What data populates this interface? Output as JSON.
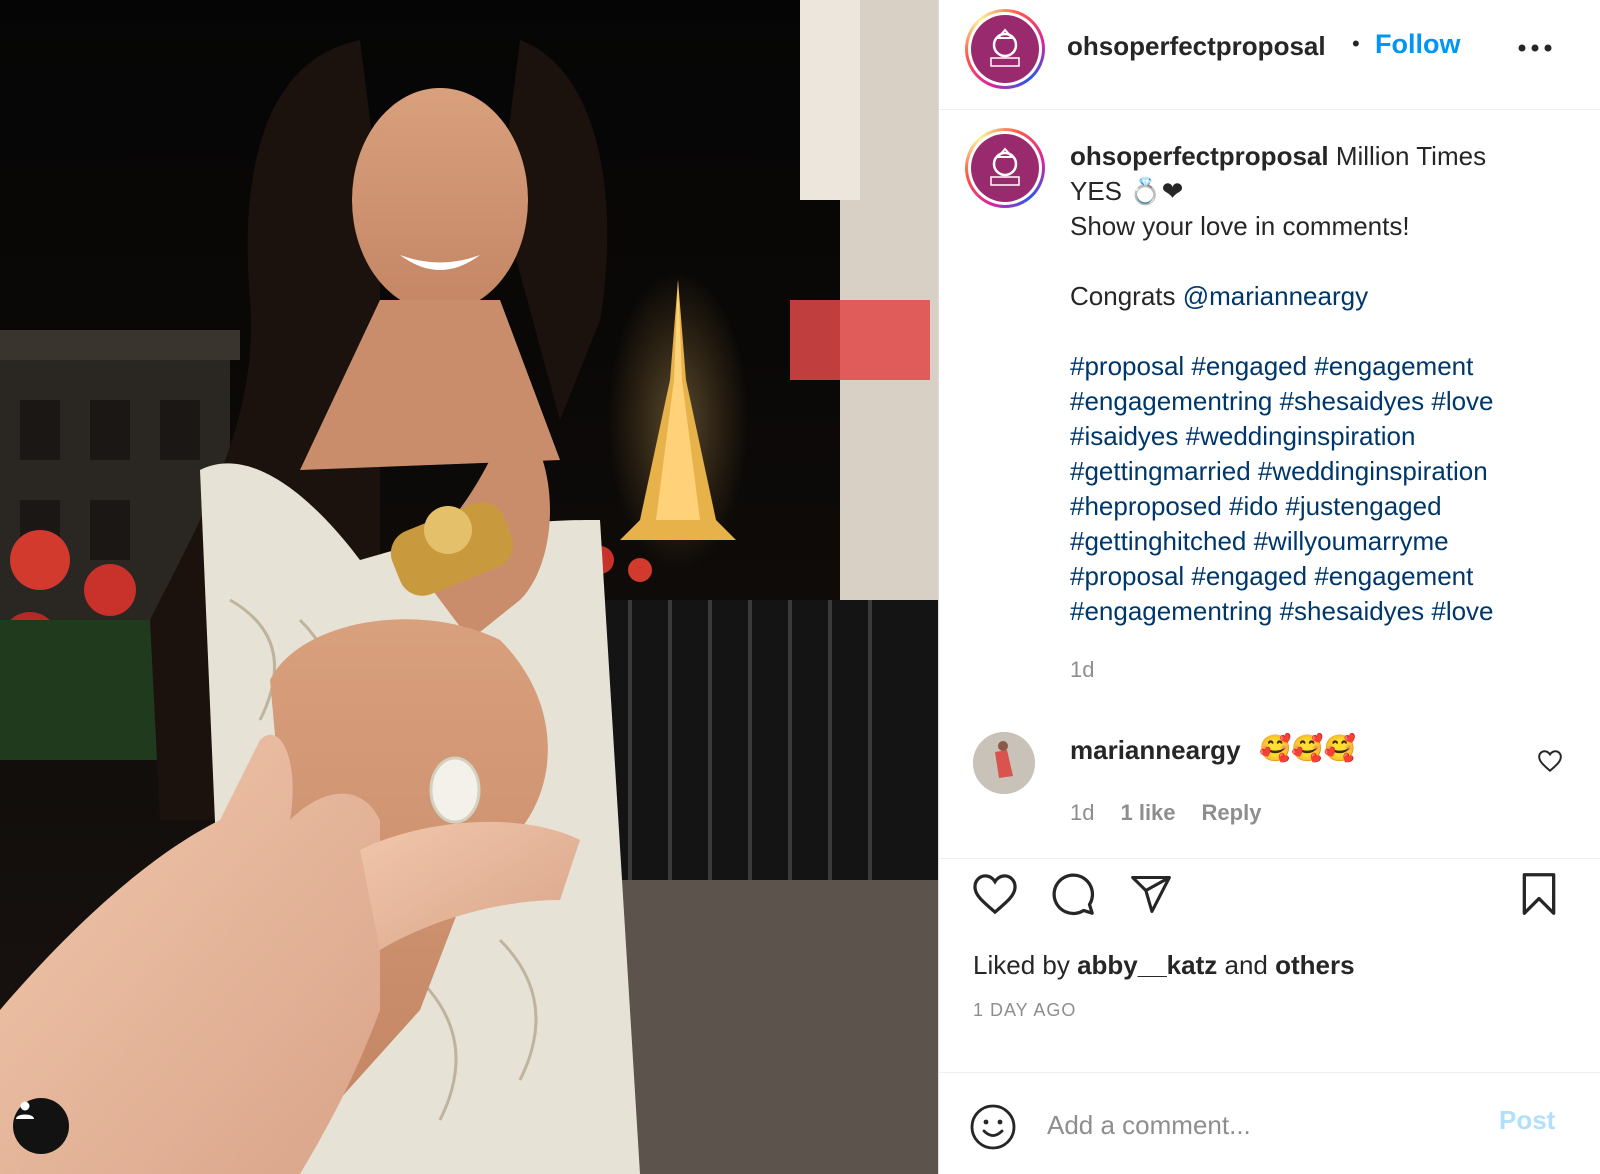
{
  "header": {
    "username": "ohsoperfectproposal",
    "separator": "•",
    "follow_label": "Follow",
    "more_icon": "more-horizontal-icon"
  },
  "caption": {
    "username": "ohsoperfectproposal",
    "line1": " Million Times",
    "line2": "YES 💍❤",
    "line3": "Show your love in comments!",
    "congrats": "Congrats ",
    "mention": "@marianneargy",
    "hashtags": [
      "#proposal #engaged #engagement",
      "#engagementring #shesaidyes #love",
      "#isaidyes #weddinginspiration",
      "#gettingmarried #weddinginspiration",
      "#heproposed #ido #justengaged",
      "#gettinghitched #willyoumarryme",
      "#proposal #engaged #engagement",
      "#engagementring #shesaidyes #love"
    ],
    "time": "1d"
  },
  "comment": {
    "username": "marianneargy",
    "text": "🥰🥰🥰",
    "time": "1d",
    "likes": "1 like",
    "reply_label": "Reply"
  },
  "likes": {
    "prefix": "Liked by ",
    "user": "abby__katz",
    "middle": " and ",
    "others": "others"
  },
  "timestamp": "1 DAY AGO",
  "add_comment": {
    "placeholder": "Add a comment...",
    "post_label": "Post"
  },
  "colors": {
    "link": "#00376b",
    "follow": "#0095f6",
    "post_disabled": "#b2dffc",
    "brand_avatar": "#9a2a6e"
  }
}
